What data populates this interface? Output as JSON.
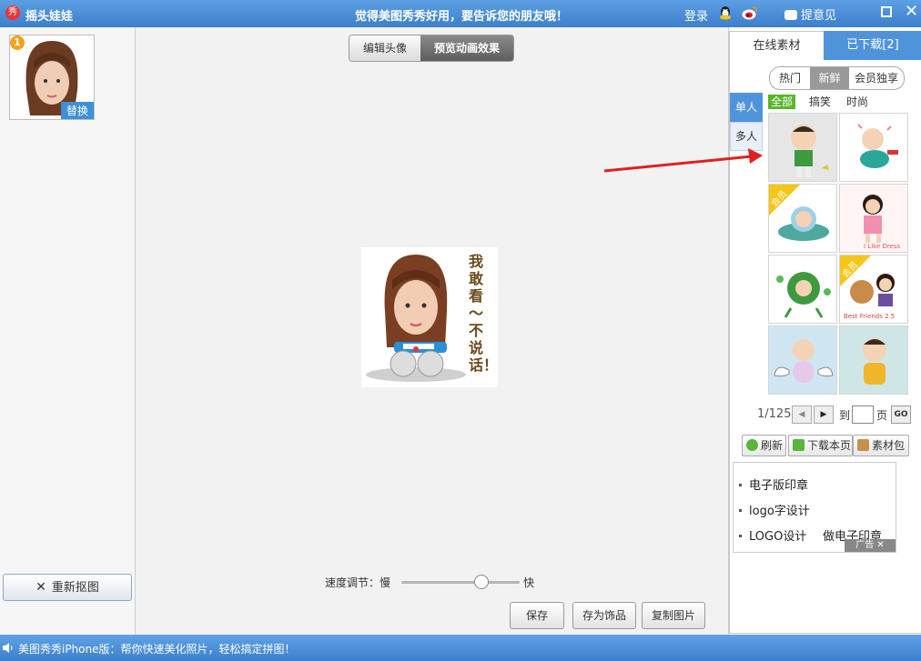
{
  "titlebar": {
    "app_icon_text": "秀",
    "app_title": "摇头娃娃",
    "slogan": "觉得美图秀秀好用，要告诉您的朋友哦！",
    "login": "登录",
    "feedback": "提意见"
  },
  "left": {
    "thumb_badge": "1",
    "replace_label": "替换",
    "recut_label": "重新抠图"
  },
  "center": {
    "tabs": [
      {
        "label": "编辑头像"
      },
      {
        "label": "预览动画效果"
      }
    ],
    "speed_label": "速度调节：慢",
    "speed_fast": "快",
    "speed_value": 0.68,
    "preview_caption": "我敢看～不说话！",
    "buttons": {
      "save": "保存",
      "save_as_decoration": "存为饰品",
      "copy": "复制图片"
    }
  },
  "right": {
    "tabs": [
      {
        "label": "在线素材"
      },
      {
        "label": "已下载[2]"
      }
    ],
    "categories": [
      "热门",
      "新鲜",
      "会员独享"
    ],
    "selected_category": "新鲜",
    "side_tabs": [
      "单人",
      "多人"
    ],
    "filters": [
      "全部",
      "搞笑",
      "时尚"
    ],
    "vip_badge": "会员",
    "item_captions": {
      "item4": "I Like Dress",
      "item6": "Best Friends 2.5"
    },
    "pager": {
      "text": "1/125",
      "goto": "到",
      "unit": "页",
      "go": "GO"
    },
    "toolbar": {
      "refresh": "刷新",
      "download_page": "下载本页",
      "pack": "素材包"
    },
    "ads": [
      "电子版印章",
      "logo字设计",
      "LOGO设计",
      "做电子印章"
    ],
    "ad_tag": "广告"
  },
  "statusbar": {
    "text": "美图秀秀iPhone版：帮你快速美化照片，轻松搞定拼图！"
  },
  "colors": {
    "titlebar": "#4a8fd6",
    "accent_blue": "#4f94db",
    "filter_green": "#58b52c",
    "annotation_red": "#e02020"
  }
}
